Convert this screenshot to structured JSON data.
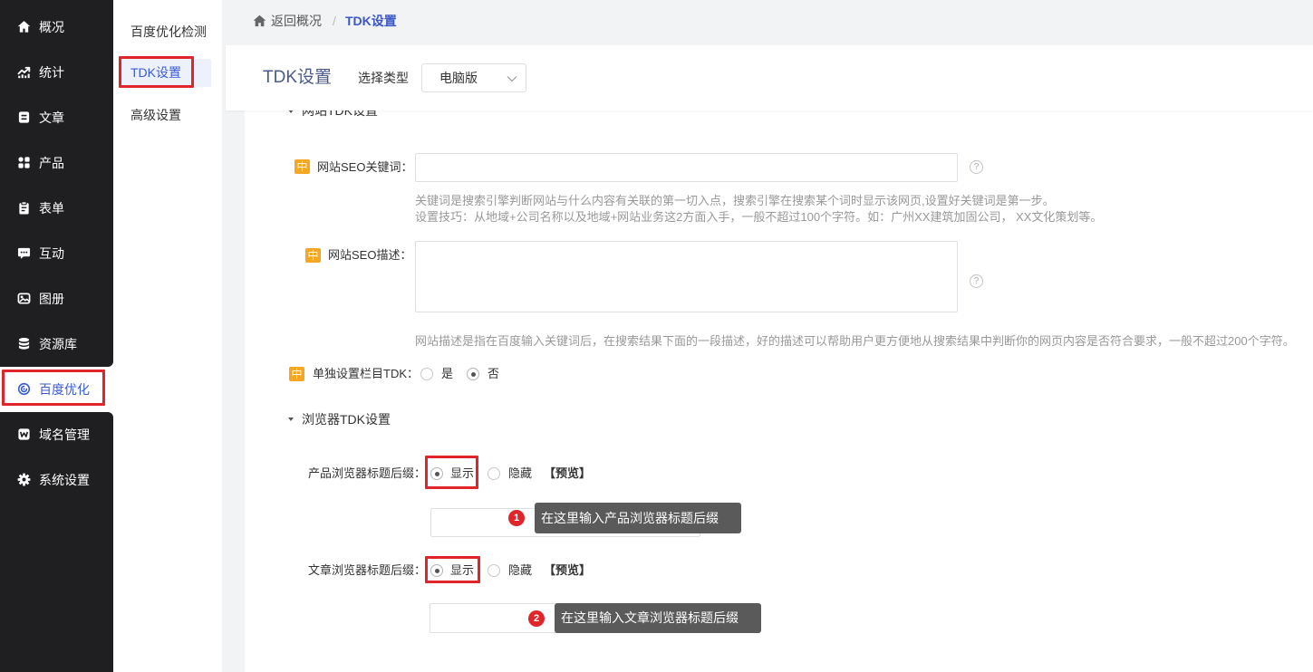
{
  "colors": {
    "sidebar_bg": "#1f1f22",
    "accent": "#3a5bd4",
    "accent_dark": "#3c58c2",
    "badge": "#f5a623",
    "annotation_red": "#e0262b",
    "tooltip_bg": "#5a5a5a",
    "help_text": "#999999",
    "page_bg": "#f2f3f5"
  },
  "sidebar": {
    "active": "百度优化",
    "items": [
      {
        "label": "概况",
        "icon": "home-icon"
      },
      {
        "label": "统计",
        "icon": "chart-icon"
      },
      {
        "label": "文章",
        "icon": "article-icon"
      },
      {
        "label": "产品",
        "icon": "grid-icon"
      },
      {
        "label": "表单",
        "icon": "clipboard-icon"
      },
      {
        "label": "互动",
        "icon": "chat-icon"
      },
      {
        "label": "图册",
        "icon": "album-icon"
      },
      {
        "label": "资源库",
        "icon": "database-icon"
      },
      {
        "label": "百度优化",
        "icon": "baidu-seo-icon"
      },
      {
        "label": "域名管理",
        "icon": "w-domain-icon"
      },
      {
        "label": "系统设置",
        "icon": "gear-icon"
      }
    ]
  },
  "subnav": {
    "active": "TDK设置",
    "items": [
      {
        "label": "百度优化检测"
      },
      {
        "label": "TDK设置"
      },
      {
        "label": "高级设置"
      }
    ]
  },
  "breadcrumb": {
    "icon": "home-icon",
    "back_label": "返回概况",
    "separator": "/",
    "current": "TDK设置"
  },
  "header": {
    "title": "TDK设置",
    "type_label": "选择类型",
    "type_value": "电脑版"
  },
  "help_glyph": "?",
  "site_tdk": {
    "section_title": "网站TDK设置",
    "keywords": {
      "badge": "中",
      "label": "网站SEO关键词：",
      "value": "",
      "help_lines": [
        "关键词是搜索引擎判断网站与什么内容有关联的第一切入点，搜索引擎在搜索某个词时显示该网页,设置好关键词是第一步。",
        "设置技巧：从地域+公司名称以及地域+网站业务这2方面入手，一般不超过100个字符。如：广州XX建筑加固公司， XX文化策划等。"
      ]
    },
    "description": {
      "badge": "中",
      "label": "网站SEO描述：",
      "value": "",
      "help": "网站描述是指在百度输入关键词后，在搜索结果下面的一段描述，好的描述可以帮助用户更方便地从搜索结果中判断你的网页内容是否符合要求，一般不超过200个字符。"
    },
    "column_tdk": {
      "badge": "中",
      "label": "单独设置栏目TDK：",
      "options": [
        "是",
        "否"
      ],
      "selected": "否"
    }
  },
  "browser_tdk": {
    "section_title": "浏览器TDK设置",
    "product_suffix": {
      "label": "产品浏览器标题后缀：",
      "options": [
        "显示",
        "隐藏"
      ],
      "selected": "显示",
      "preview": "【预览】",
      "value": ""
    },
    "article_suffix": {
      "label": "文章浏览器标题后缀：",
      "options": [
        "显示",
        "隐藏"
      ],
      "selected": "显示",
      "preview": "【预览】",
      "value": ""
    }
  },
  "annotations": [
    {
      "number": "1",
      "text": "在这里输入产品浏览器标题后缀"
    },
    {
      "number": "2",
      "text": "在这里输入文章浏览器标题后缀"
    }
  ]
}
